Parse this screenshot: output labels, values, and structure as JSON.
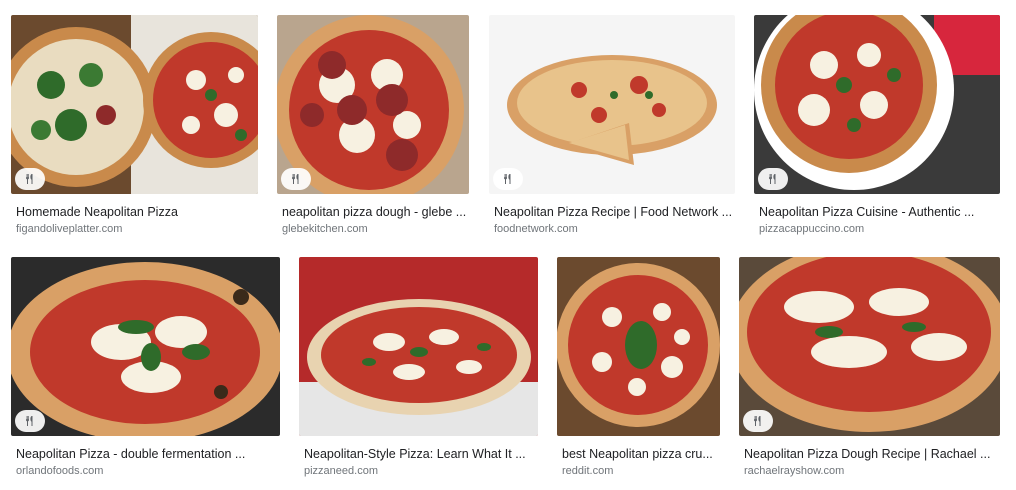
{
  "results": [
    {
      "title": "Homemade Neapolitan Pizza",
      "source": "figandoliveplatter.com",
      "icon": "recipe-icon"
    },
    {
      "title": "neapolitan pizza dough - glebe ...",
      "source": "glebekitchen.com",
      "icon": "recipe-icon"
    },
    {
      "title": "Neapolitan Pizza Recipe | Food Network ...",
      "source": "foodnetwork.com",
      "icon": "recipe-icon"
    },
    {
      "title": "Neapolitan Pizza Cuisine - Authentic ...",
      "source": "pizzacappuccino.com",
      "icon": "recipe-icon"
    },
    {
      "title": "Neapolitan Pizza - double fermentation ...",
      "source": "orlandofoods.com",
      "icon": "recipe-icon"
    },
    {
      "title": "Neapolitan-Style Pizza: Learn What It ...",
      "source": "pizzaneed.com",
      "icon": ""
    },
    {
      "title": "best Neapolitan pizza cru...",
      "source": "reddit.com",
      "icon": ""
    },
    {
      "title": "Neapolitan Pizza Dough Recipe | Rachael ...",
      "source": "rachaelrayshow.com",
      "icon": "recipe-icon"
    }
  ],
  "colors": {
    "title": "#202124",
    "source": "#70757a",
    "crust": "#d9a066",
    "sauce": "#c0392b",
    "cheese": "#f7f1e1",
    "basil": "#2f6b2a"
  }
}
